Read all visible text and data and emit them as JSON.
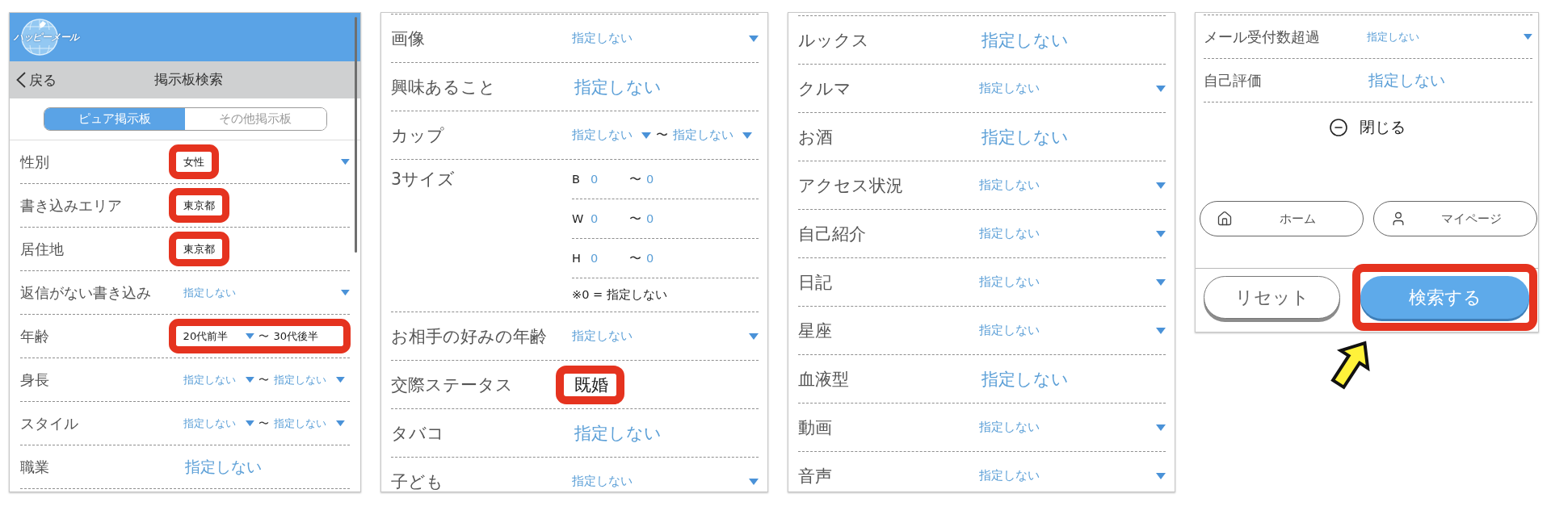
{
  "screens": [
    {
      "kind": "top",
      "header": {
        "logo": "ハッピーメール"
      },
      "nav": {
        "back": "戻る",
        "title": "掲示板検索"
      },
      "tabs": [
        {
          "label": "ピュア掲示板",
          "selected": true
        },
        {
          "label": "その他掲示板",
          "selected": false
        }
      ],
      "rows": [
        {
          "kind": "select",
          "label": "性別",
          "value": "女性",
          "set": true,
          "highlighted": true
        },
        {
          "kind": "area",
          "label": "書き込みエリア",
          "value": "東京都",
          "set": true,
          "highlighted": true
        },
        {
          "kind": "area",
          "label": "居住地",
          "value": "東京都",
          "set": true,
          "highlighted": true
        },
        {
          "kind": "select",
          "label": "返信がない書き込み",
          "value": "指定しない",
          "set": false,
          "highlighted": false
        },
        {
          "kind": "range",
          "label": "年齢",
          "from": {
            "value": "20代前半",
            "set": true
          },
          "separator": "〜",
          "to": {
            "value": "30代後半",
            "set": true
          },
          "highlighted": true
        },
        {
          "kind": "range",
          "label": "身長",
          "from": {
            "value": "指定しない",
            "set": false
          },
          "separator": "〜",
          "to": {
            "value": "指定しない",
            "set": false
          },
          "highlighted": false
        },
        {
          "kind": "range",
          "label": "スタイル",
          "from": {
            "value": "指定しない",
            "set": false
          },
          "separator": "〜",
          "to": {
            "value": "指定しない",
            "set": false
          },
          "highlighted": false
        },
        {
          "kind": "choice",
          "label": "職業",
          "value": "指定しない",
          "set": false,
          "highlighted": false
        }
      ]
    },
    {
      "kind": "middle",
      "rows": [
        {
          "kind": "select",
          "label": "画像",
          "value": "指定しない",
          "set": false,
          "highlighted": false
        },
        {
          "kind": "choice",
          "label": "興味あること",
          "value": "指定しない",
          "set": false,
          "highlighted": false
        },
        {
          "kind": "range",
          "label": "カップ",
          "from": {
            "value": "指定しない",
            "set": false
          },
          "separator": "〜",
          "to": {
            "value": "指定しない",
            "set": false
          },
          "highlighted": false
        },
        {
          "kind": "sizes",
          "label": "3サイズ",
          "measures": [
            {
              "name": "B",
              "from": "0",
              "separator": "〜",
              "to": "0"
            },
            {
              "name": "W",
              "from": "0",
              "separator": "〜",
              "to": "0"
            },
            {
              "name": "H",
              "from": "0",
              "separator": "〜",
              "to": "0"
            }
          ],
          "note": "※0 = 指定しない",
          "highlighted": false
        },
        {
          "kind": "select",
          "label": "お相手の好みの年齢",
          "value": "指定しない",
          "set": false,
          "highlighted": false
        },
        {
          "kind": "choice",
          "label": "交際ステータス",
          "value": "既婚",
          "set": true,
          "highlighted": true
        },
        {
          "kind": "choice",
          "label": "タバコ",
          "value": "指定しない",
          "set": false,
          "highlighted": false
        },
        {
          "kind": "select",
          "label": "子ども",
          "value": "指定しない",
          "set": false,
          "highlighted": false
        }
      ]
    },
    {
      "kind": "middle",
      "rows": [
        {
          "kind": "choice",
          "label": "ルックス",
          "value": "指定しない",
          "set": false,
          "highlighted": false
        },
        {
          "kind": "select",
          "label": "クルマ",
          "value": "指定しない",
          "set": false,
          "highlighted": false
        },
        {
          "kind": "choice",
          "label": "お酒",
          "value": "指定しない",
          "set": false,
          "highlighted": false
        },
        {
          "kind": "select",
          "label": "アクセス状況",
          "value": "指定しない",
          "set": false,
          "highlighted": false
        },
        {
          "kind": "select",
          "label": "自己紹介",
          "value": "指定しない",
          "set": false,
          "highlighted": false
        },
        {
          "kind": "select",
          "label": "日記",
          "value": "指定しない",
          "set": false,
          "highlighted": false
        },
        {
          "kind": "select",
          "label": "星座",
          "value": "指定しない",
          "set": false,
          "highlighted": false
        },
        {
          "kind": "choice",
          "label": "血液型",
          "value": "指定しない",
          "set": false,
          "highlighted": false
        },
        {
          "kind": "select",
          "label": "動画",
          "value": "指定しない",
          "set": false,
          "highlighted": false
        },
        {
          "kind": "select",
          "label": "音声",
          "value": "指定しない",
          "set": false,
          "highlighted": false
        }
      ]
    },
    {
      "kind": "bottom",
      "rows": [
        {
          "kind": "select",
          "label": "メール受付数超過",
          "value": "指定しない",
          "set": false,
          "highlighted": false
        },
        {
          "kind": "choice",
          "label": "自己評価",
          "value": "指定しない",
          "set": false,
          "highlighted": false
        }
      ],
      "close": "閉じる",
      "links": [
        {
          "kind": "home",
          "label": "ホーム"
        },
        {
          "kind": "profile",
          "label": "マイページ"
        }
      ],
      "actions": [
        {
          "kind": "reset",
          "label": "リセット",
          "highlighted": false
        },
        {
          "kind": "search",
          "label": "検索する",
          "highlighted": true
        }
      ]
    }
  ]
}
